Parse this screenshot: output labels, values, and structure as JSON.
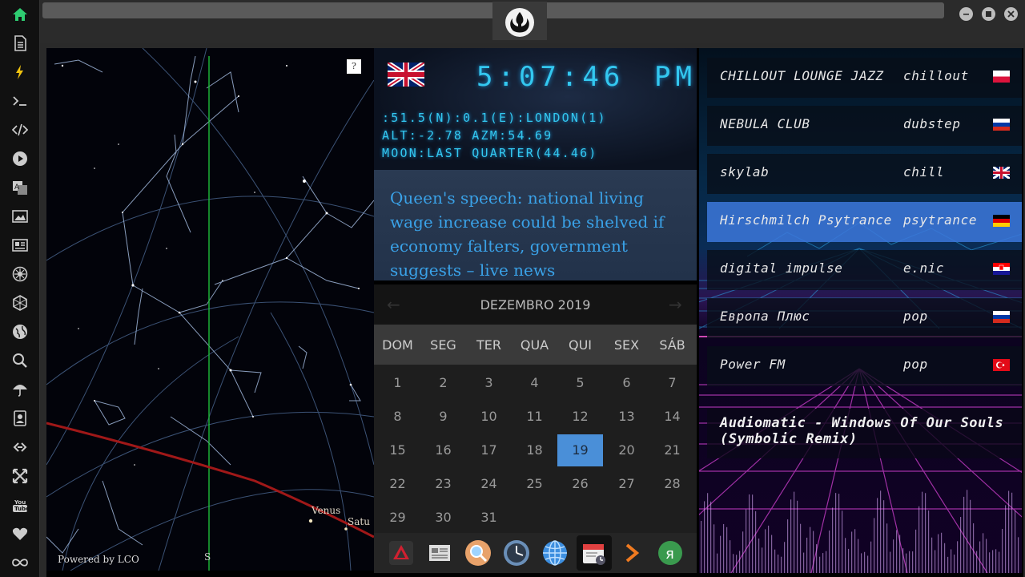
{
  "sidebar": {
    "items": [
      {
        "icon": "home-icon",
        "color": "#2ecc71"
      },
      {
        "icon": "document-icon"
      },
      {
        "icon": "lightning-icon",
        "color": "#f1c40f"
      },
      {
        "icon": "terminal-icon"
      },
      {
        "icon": "code-icon"
      },
      {
        "icon": "play-icon"
      },
      {
        "icon": "translate-icon"
      },
      {
        "icon": "image-icon"
      },
      {
        "icon": "newspaper-icon"
      },
      {
        "icon": "rebel-icon"
      },
      {
        "icon": "hexagon-icon"
      },
      {
        "icon": "globe-icon"
      },
      {
        "icon": "search-icon"
      },
      {
        "icon": "umbrella-icon"
      },
      {
        "icon": "contact-icon"
      },
      {
        "icon": "link-icon"
      },
      {
        "icon": "expand-icon"
      },
      {
        "icon": "youtube-icon",
        "label": "You Tube"
      },
      {
        "icon": "heart-icon"
      },
      {
        "icon": "infinity-icon"
      }
    ]
  },
  "header": {
    "emblem": "rebel-alliance-icon"
  },
  "skymap": {
    "help": "?",
    "credit": "Powered by LCO",
    "south": "S",
    "planets": [
      "Venus",
      "Satu"
    ]
  },
  "clock": {
    "flag": "uk-flag",
    "time": "5:07:46",
    "ampm": "PM",
    "location": ":51.5(N):0.1(E):LONDON(1)",
    "altaz": "ALT:-2.78 AZM:54.69",
    "moon": "MOON:LAST QUARTER(44.46)"
  },
  "news": {
    "headline": "Queen's speech: national living wage increase could be shelved if economy falters, government suggests – live news"
  },
  "calendar": {
    "month": "DEZEMBRO 2019",
    "weekdays": [
      "DOM",
      "SEG",
      "TER",
      "QUA",
      "QUI",
      "SEX",
      "SÁB"
    ],
    "days": [
      "1",
      "2",
      "3",
      "4",
      "5",
      "6",
      "7",
      "8",
      "9",
      "10",
      "11",
      "12",
      "13",
      "14",
      "15",
      "16",
      "17",
      "18",
      "19",
      "20",
      "21",
      "22",
      "23",
      "24",
      "25",
      "26",
      "27",
      "28",
      "29",
      "30",
      "31"
    ],
    "today": "19",
    "prev": "←",
    "next": "→"
  },
  "dock": {
    "items": [
      "app-launcher-icon",
      "news-reader-icon",
      "search-icon",
      "clock-icon",
      "globe-icon",
      "calendar-icon",
      "play-arrow-icon",
      "yandex-icon"
    ]
  },
  "radio": {
    "stations": [
      {
        "name": "CHILLOUT LOUNGE JAZZ",
        "genre": "chillout",
        "flag": "poland-flag"
      },
      {
        "name": "NEBULA CLUB",
        "genre": "dubstep",
        "flag": "russia-flag"
      },
      {
        "name": "skylab",
        "genre": "chill",
        "flag": "uk-flag"
      },
      {
        "name": "Hirschmilch Psytrance",
        "genre": "psytrance",
        "flag": "germany-flag"
      },
      {
        "name": "digital impulse",
        "genre": "e.nic",
        "flag": "croatia-flag"
      },
      {
        "name": "Европа Плюс",
        "genre": "pop",
        "flag": "russia-flag"
      },
      {
        "name": "Power FM",
        "genre": "pop",
        "flag": "turkey-flag"
      }
    ],
    "now_playing": "Audiomatic - Windows Of Our Souls (Symbolic Remix)"
  }
}
